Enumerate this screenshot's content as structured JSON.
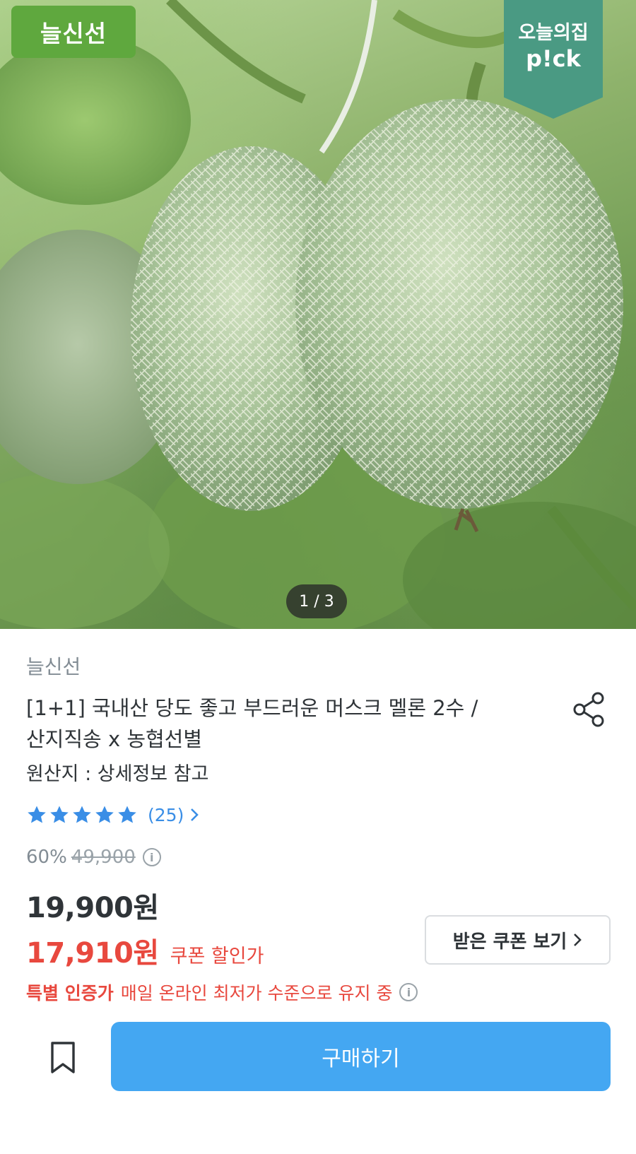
{
  "hero": {
    "brand_badge": "늘신선",
    "pick_badge_line1": "오늘의집",
    "pick_badge_line2": "p!ck",
    "pager": "1 / 3"
  },
  "product": {
    "brand": "늘신선",
    "title_line1": "[1+1] 국내산 당도 좋고 부드러운 머스크 멜론 2수 /",
    "title_line2": "산지직송 x 농협선별",
    "origin": "원산지 : 상세정보 참고",
    "rating": {
      "stars": 5,
      "count_text": "(25)"
    },
    "discount": "60%",
    "original_price": "49,900",
    "sale_price": "19,900원",
    "coupon_price": "17,910원",
    "coupon_label": "쿠폰 할인가",
    "coupon_button": "받은 쿠폰 보기",
    "certified_strong": "특별 인증가",
    "certified_rest": "매일 온라인 최저가 수준으로 유지 중"
  },
  "actions": {
    "buy_label": "구매하기"
  },
  "colors": {
    "accent_blue": "#44a7f2",
    "sale_red": "#e8483e",
    "brand_green": "#5fa83e",
    "pick_teal": "#4a9a83"
  },
  "icons": {
    "share": "share-icon",
    "star": "star-icon",
    "info": "info-icon",
    "bookmark": "bookmark-icon",
    "chevron": "chevron-right-icon"
  }
}
